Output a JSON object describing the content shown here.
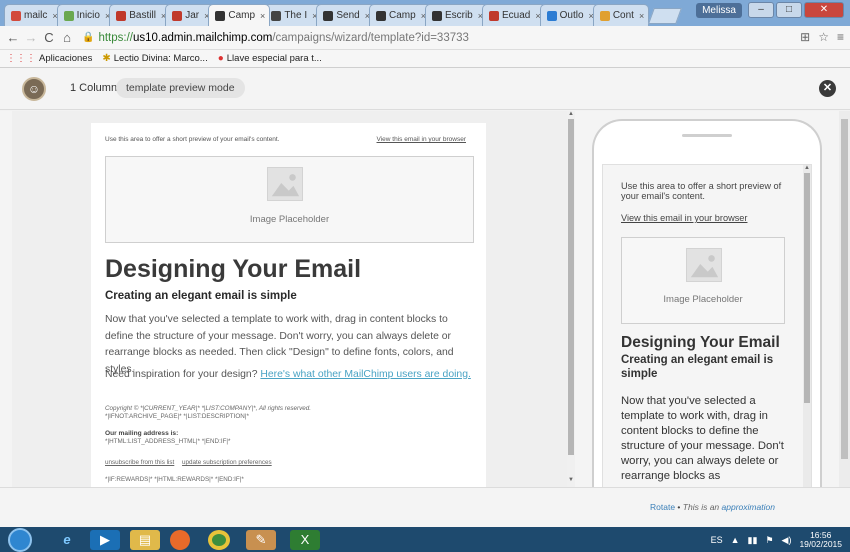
{
  "browser": {
    "tabs": [
      {
        "label": "mailc",
        "color": "#d24a3c"
      },
      {
        "label": "Inicio",
        "color": "#6aa84f"
      },
      {
        "label": "Bastill",
        "color": "#c0392b"
      },
      {
        "label": "Jar",
        "color": "#c0392b"
      },
      {
        "label": "Camp",
        "color": "#333333",
        "active": true
      },
      {
        "label": "The I",
        "color": "#444444"
      },
      {
        "label": "Send",
        "color": "#333333"
      },
      {
        "label": "Camp",
        "color": "#333333"
      },
      {
        "label": "Escrib",
        "color": "#333333"
      },
      {
        "label": "Ecuad",
        "color": "#c0392b"
      },
      {
        "label": "Outlo",
        "color": "#2b7cd3"
      },
      {
        "label": "Cont",
        "color": "#e0a030"
      }
    ],
    "profile": "Melissa",
    "url": {
      "proto": "https://",
      "host": "us10.admin.mailchimp.com",
      "path": "/campaigns/wizard/template?id=33733"
    },
    "bookmarks": [
      {
        "label": "Aplicaciones",
        "icon": "apps-grid-icon"
      },
      {
        "label": "Lectio Divina: Marco...",
        "icon": "bookmark-icon"
      },
      {
        "label": "Llave especial para t...",
        "icon": "bookmark-icon"
      }
    ]
  },
  "header": {
    "column_label": "1 Column",
    "mode_label": "template preview mode",
    "close_icon": "close-icon"
  },
  "email": {
    "preheader": "Use this area to offer a short preview of your email's content.",
    "view_in_browser": "View this email in your browser",
    "image_placeholder": "Image Placeholder",
    "title": "Designing Your Email",
    "subtitle": "Creating an elegant email is simple",
    "body": "Now that you've selected a template to work with, drag in content blocks to define the structure of your message. Don't worry, you can always delete or rearrange blocks as needed. Then click \"Design\" to define fonts, colors, and styles.",
    "inspiration_text": "Need inspiration for your design?",
    "inspiration_link": "Here's what other MailChimp users are doing.",
    "copyright_line1": "Copyright © *|CURRENT_YEAR|* *|LIST:COMPANY|*, All rights reserved.",
    "copyright_line2": "*|IFNOT:ARCHIVE_PAGE|* *|LIST:DESCRIPTION|*",
    "address_heading": "Our mailing address is:",
    "address": "*|HTML:LIST_ADDRESS_HTML|* *|END:IF|*",
    "unsubscribe": "unsubscribe from this list",
    "update_prefs": "update subscription preferences",
    "rewards": "*|IF:REWARDS|* *|HTML:REWARDS|* *|END:IF|*"
  },
  "mobile": {
    "preheader": "Use this area to offer a short preview of your email's content.",
    "view_in_browser": "View this email in your browser",
    "image_placeholder": "Image Placeholder",
    "title": "Designing Your Email",
    "subtitle": "Creating an elegant email is simple",
    "body": "Now that you've selected a template to work with, drag in content blocks to define the structure of your message. Don't worry, you can always delete or rearrange blocks as"
  },
  "footer": {
    "rotate": "Rotate",
    "separator": "•",
    "approx_text": "This is an",
    "approx_link": "approximation"
  },
  "taskbar": {
    "lang": "ES",
    "time": "16:56",
    "date": "19/02/2015",
    "apps": [
      "ie-icon",
      "media-player-icon",
      "file-explorer-icon",
      "firefox-icon",
      "chrome-icon",
      "paint-icon",
      "excel-icon"
    ]
  }
}
